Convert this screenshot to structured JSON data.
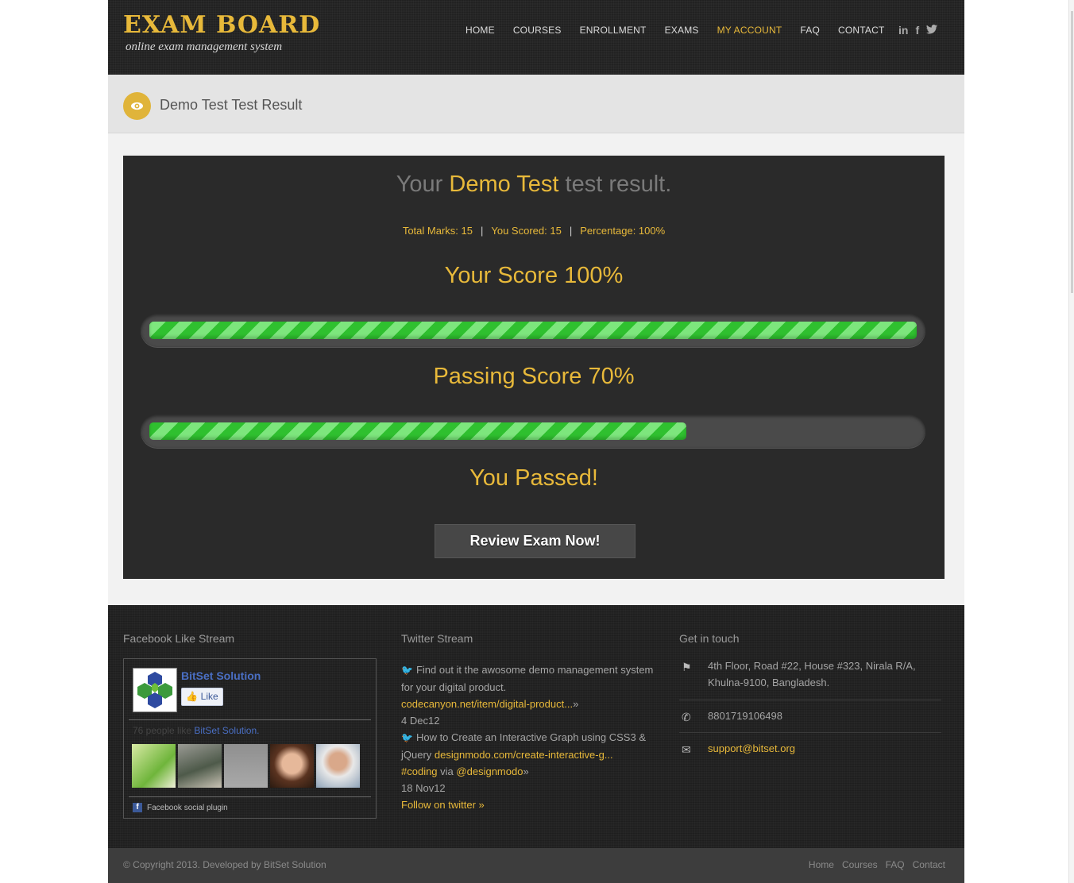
{
  "logo": {
    "title": "EXAM BOARD",
    "subtitle": "online exam management system"
  },
  "nav": {
    "items": [
      "HOME",
      "COURSES",
      "ENROLLMENT",
      "EXAMS",
      "MY ACCOUNT",
      "FAQ",
      "CONTACT"
    ],
    "active": "MY ACCOUNT"
  },
  "social": {
    "linkedin": "in",
    "facebook": "f",
    "twitter": "t"
  },
  "page": {
    "title": "Demo Test Test Result"
  },
  "result": {
    "head_prefix": "Your",
    "test_name": "Demo Test",
    "head_suffix": "test result.",
    "total_marks": "Total Marks: 15",
    "you_scored": "You Scored: 15",
    "percentage": "Percentage: 100%",
    "sep": "|",
    "your_score_label": "Your Score 100%",
    "your_score_value": 1.0,
    "passing_score_label": "Passing Score 70%",
    "passing_score_value": 0.7,
    "status": "You Passed!",
    "review_button": "Review Exam Now!"
  },
  "footer": {
    "facebook": {
      "title": "Facebook Like Stream",
      "page_name": "BitSet Solution",
      "like_label": "Like",
      "people_count": "76 people like",
      "people_page": "BitSet Solution.",
      "plugin_label": "Facebook social plugin"
    },
    "twitter": {
      "title": "Twitter Stream",
      "tweet1_text": "Find out it the awosome demo management system for your digital product.",
      "tweet1_link": "codecanyon.net/item/digital-product...",
      "tweet1_more": "»",
      "tweet1_date": "4 Dec12",
      "tweet2_text": "How to Create an Interactive Graph using CSS3 & jQuery",
      "tweet2_link": "designmodo.com/create-interactive-g...",
      "tweet2_tag": "#coding",
      "tweet2_via": "via",
      "tweet2_user": "@designmodo",
      "tweet2_more": "»",
      "tweet2_date": "18 Nov12",
      "follow": "Follow on twitter »"
    },
    "contact": {
      "title": "Get in touch",
      "address": "4th Floor, Road #22, House #323, Nirala R/A, Khulna-9100, Bangladesh.",
      "phone": "8801719106498",
      "email": "support@bitset.org"
    },
    "copyright": "© Copyright 2013. Developed by BitSet Solution",
    "links": [
      "Home",
      "Courses",
      "FAQ",
      "Contact"
    ]
  },
  "colors": {
    "accent": "#e8b93a",
    "panel": "#2a2a2a",
    "progress": "#2fc02f"
  }
}
